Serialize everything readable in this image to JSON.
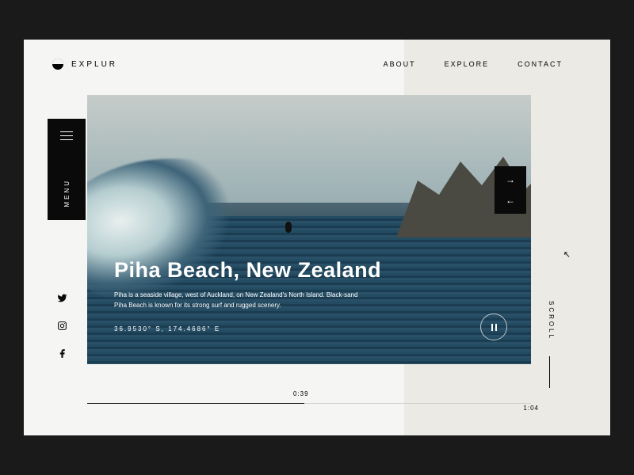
{
  "brand": {
    "name": "EXPLUR"
  },
  "nav": {
    "about": "ABOUT",
    "explore": "EXPLORE",
    "contact": "CONTACT"
  },
  "menu": {
    "label": "MENU"
  },
  "hero": {
    "title": "Piha Beach, New Zealand",
    "description": "Piha is a seaside village, west of Auckland, on New Zealand's North Island. Black-sand Piha Beach is known for its strong surf and rugged scenery.",
    "coordinates": "36.9530° S, 174.4686° E"
  },
  "scroll": {
    "label": "SCROLL"
  },
  "timeline": {
    "current": "0:39",
    "total": "1:04"
  }
}
